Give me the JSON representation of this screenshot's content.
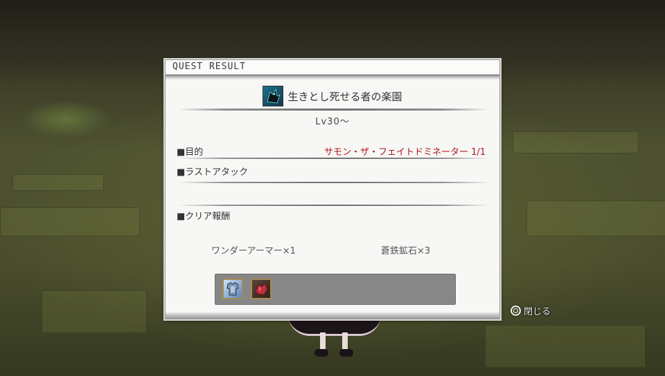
{
  "dialog": {
    "title": "QUEST RESULT",
    "quest_icon": "dark-beast-icon",
    "quest_name": "生きとし死せる者の楽園",
    "level": "Lv30～",
    "objective_label": "■目的",
    "objective_value": "サモン・ザ・フェイトドミネーター  1/1",
    "objective_color": "#b0141e",
    "last_attack_label": "■ラストアタック",
    "clear_reward_label": "■クリア報酬",
    "rewards": [
      {
        "name": "ワンダーアーマー×1",
        "icon": "armor-icon"
      },
      {
        "name": "蒼鉄鉱石×3",
        "icon": "ore-icon"
      }
    ]
  },
  "close_hint": {
    "icon": "circle-button-icon",
    "label": "閉じる"
  }
}
